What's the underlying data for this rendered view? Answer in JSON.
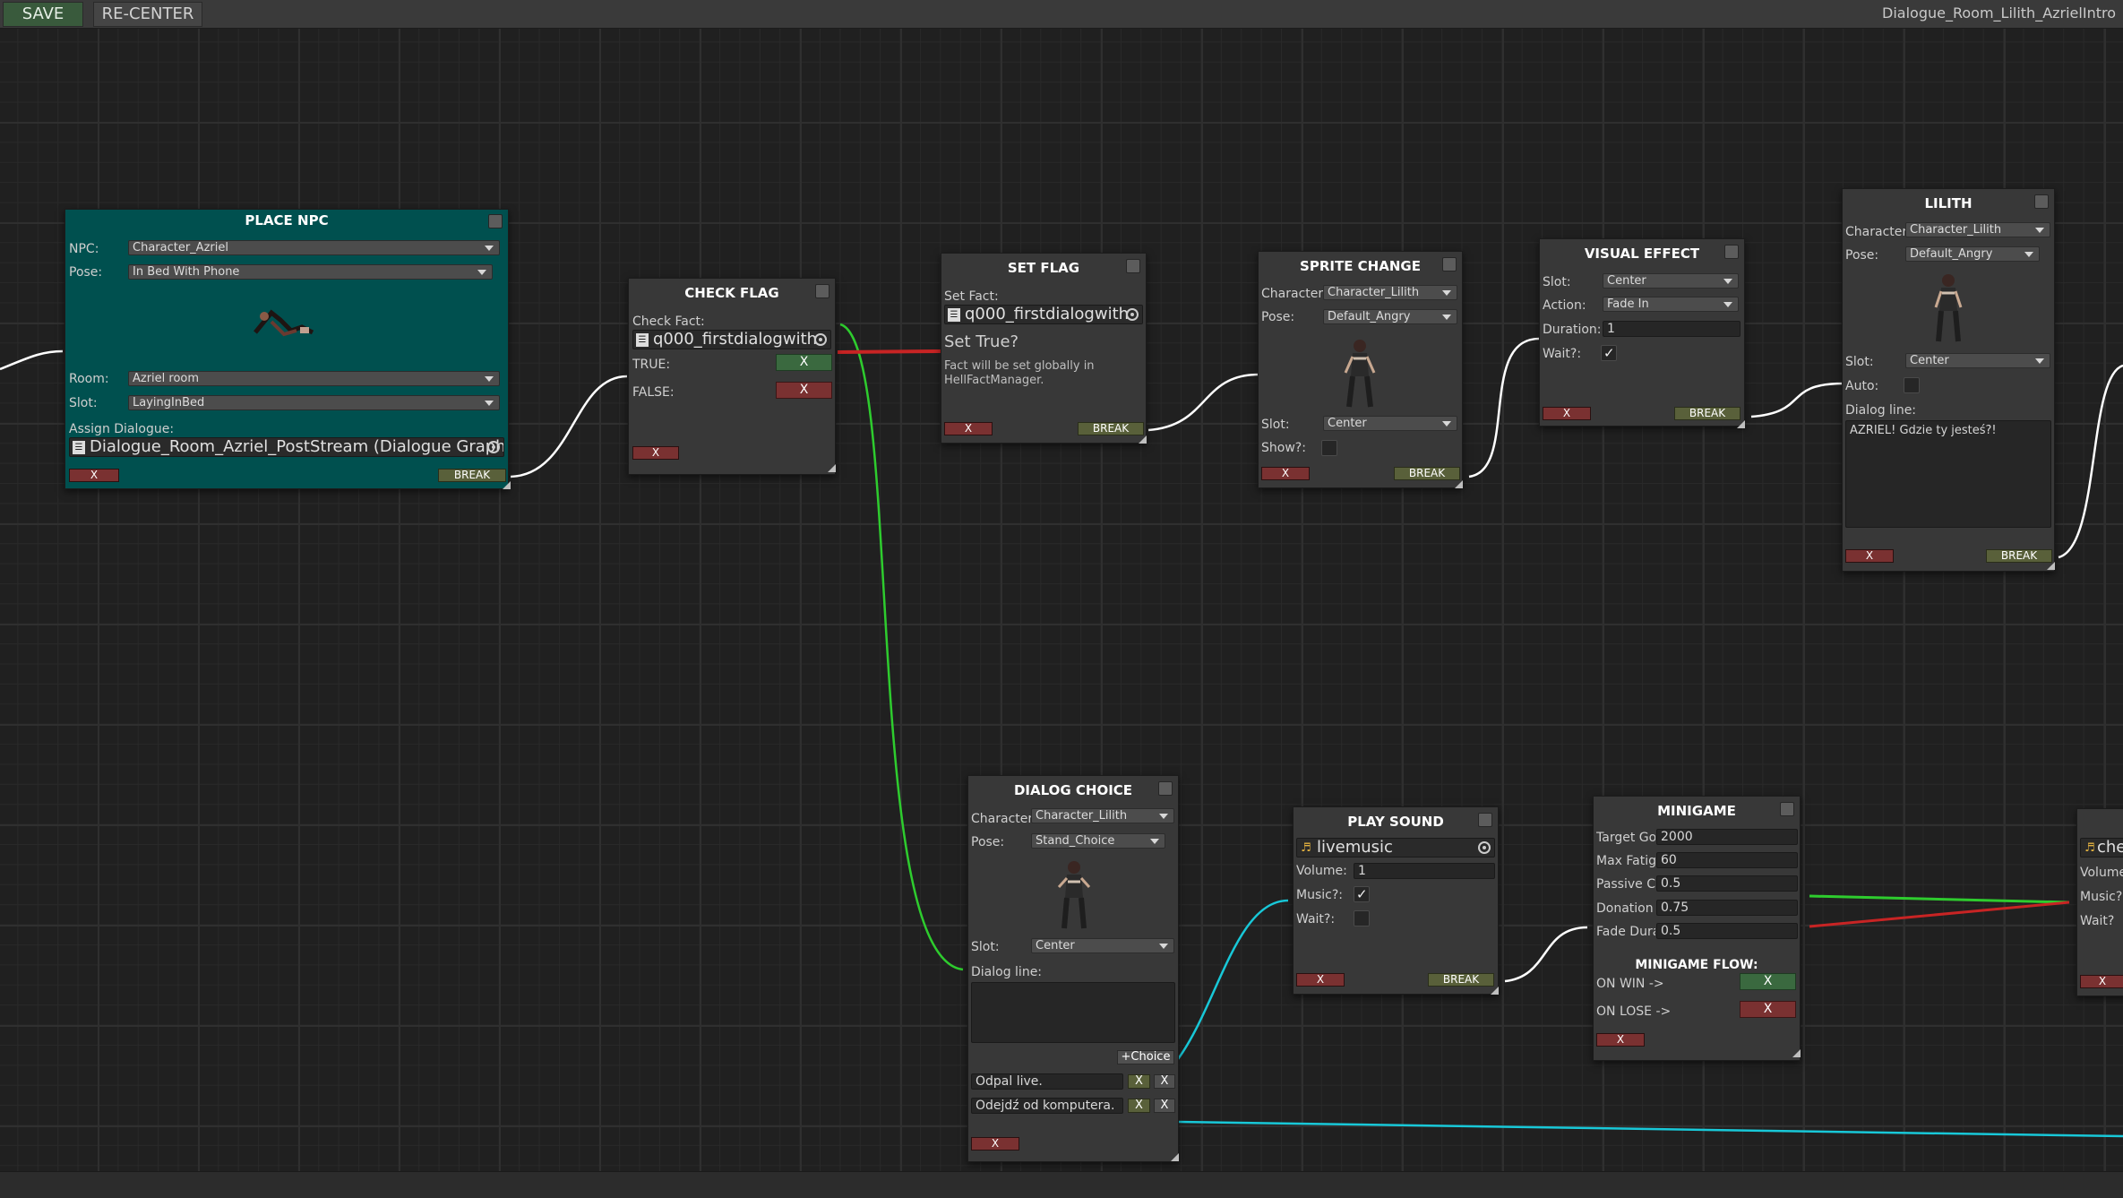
{
  "toolbar": {
    "save": "SAVE",
    "recenter": "RE-CENTER",
    "graph_title": "Dialogue_Room_Lilith_AzrielIntro"
  },
  "wire_colors": {
    "default": "#ffffff",
    "true": "#2ecc2e",
    "false": "#c82424",
    "audio": "#18c8d8"
  },
  "common": {
    "x": "X",
    "break": "BREAK"
  },
  "place_npc": {
    "title": "PLACE NPC",
    "npc_label": "NPC:",
    "npc_value": "Character_Azriel",
    "pose_label": "Pose:",
    "pose_value": "In Bed With Phone",
    "room_label": "Room:",
    "room_value": "Azriel room",
    "slot_label": "Slot:",
    "slot_value": "LayingInBed",
    "assign_label": "Assign Dialogue:",
    "assign_value": "Dialogue_Room_Azriel_PostStream (Dialogue Graph"
  },
  "check_flag": {
    "title": "CHECK FLAG",
    "fact_label": "Check Fact:",
    "fact_value": "q000_firstdialogwith",
    "true_label": "TRUE:",
    "false_label": "FALSE:"
  },
  "set_flag": {
    "title": "SET FLAG",
    "fact_label": "Set Fact:",
    "fact_value": "q000_firstdialogwith",
    "set_true": "Set True?",
    "note": "Fact will be set globally in HellFactManager."
  },
  "sprite_change": {
    "title": "SPRITE CHANGE",
    "char_label": "Character",
    "char_value": "Character_Lilith",
    "pose_label": "Pose:",
    "pose_value": "Default_Angry",
    "slot_label": "Slot:",
    "slot_value": "Center",
    "show_label": "Show?:"
  },
  "visual_effect": {
    "title": "VISUAL EFFECT",
    "slot_label": "Slot:",
    "slot_value": "Center",
    "action_label": "Action:",
    "action_value": "Fade In",
    "duration_label": "Duration:",
    "duration_value": "1",
    "wait_label": "Wait?:"
  },
  "lilith": {
    "title": "LILITH",
    "char_label": "Character",
    "char_value": "Character_Lilith",
    "pose_label": "Pose:",
    "pose_value": "Default_Angry",
    "slot_label": "Slot:",
    "slot_value": "Center",
    "auto_label": "Auto:",
    "dialog_label": "Dialog line:",
    "dialog_text": "AZRIEL! Gdzie ty jesteś?!"
  },
  "dialog_choice": {
    "title": "DIALOG CHOICE",
    "char_label": "Character",
    "char_value": "Character_Lilith",
    "pose_label": "Pose:",
    "pose_value": "Stand_Choice",
    "slot_label": "Slot:",
    "slot_value": "Center",
    "dialog_label": "Dialog line:",
    "add_choice": "+Choice",
    "choices": [
      "Odpal live.",
      "Odejdź od komputera."
    ]
  },
  "play_sound": {
    "title": "PLAY SOUND",
    "clip": "livemusic",
    "volume_label": "Volume:",
    "volume_value": "1",
    "music_label": "Music?:",
    "wait_label": "Wait?:"
  },
  "minigame": {
    "title": "MINIGAME",
    "fields": [
      {
        "label": "Target Go",
        "value": "2000"
      },
      {
        "label": "Max Fatig",
        "value": "60"
      },
      {
        "label": "Passive C",
        "value": "0.5"
      },
      {
        "label": "Donation",
        "value": "0.75"
      },
      {
        "label": "Fade Dura",
        "value": "0.5"
      }
    ],
    "flow_title": "MINIGAME FLOW:",
    "win_label": "ON WIN ->",
    "lose_label": "ON LOSE ->"
  },
  "partial": {
    "clip": "che",
    "volume_label": "Volume",
    "music_label": "Music?",
    "wait_label": "Wait?"
  }
}
